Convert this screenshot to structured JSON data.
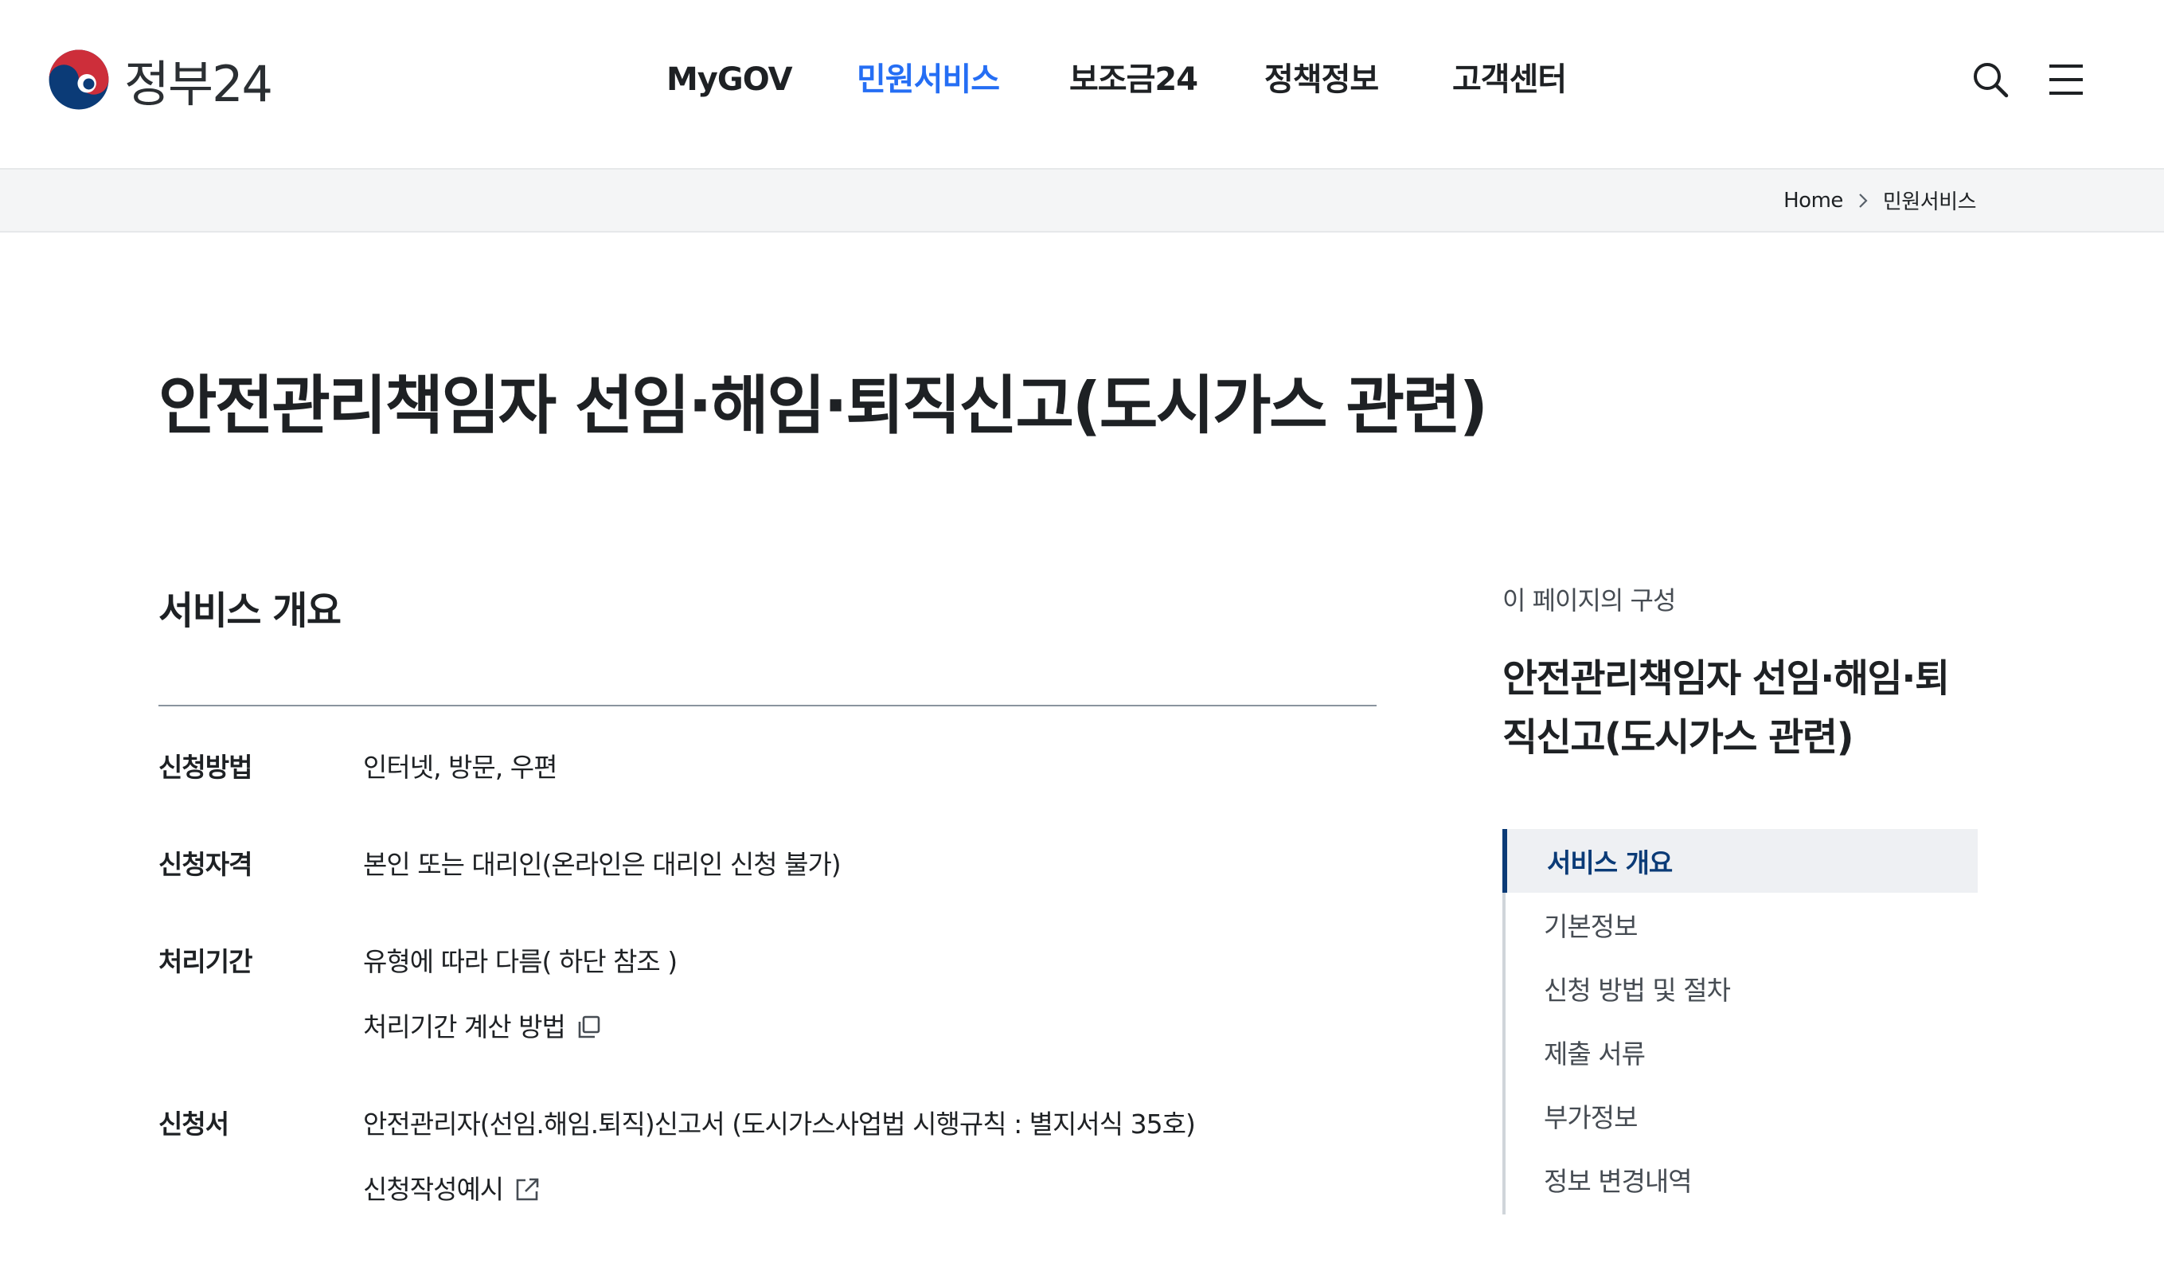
{
  "header": {
    "logo_text": "정부24",
    "nav": [
      {
        "label": "MyGOV",
        "active": false
      },
      {
        "label": "민원서비스",
        "active": true
      },
      {
        "label": "보조금24",
        "active": false
      },
      {
        "label": "정책정보",
        "active": false
      },
      {
        "label": "고객센터",
        "active": false
      }
    ],
    "icons": [
      "search-icon",
      "menu-icon"
    ],
    "accent_color": "#256ef4"
  },
  "breadcrumb": {
    "items": [
      "Home",
      "민원서비스"
    ]
  },
  "page": {
    "title": "안전관리책임자 선임·해임·퇴직신고(도시가스 관련)"
  },
  "overview": {
    "title": "서비스 개요",
    "rows": [
      {
        "label": "신청방법",
        "values": [
          "인터넷, 방문, 우편"
        ]
      },
      {
        "label": "신청자격",
        "values": [
          "본인 또는 대리인(온라인은 대리인 신청 불가)"
        ]
      },
      {
        "label": "처리기간",
        "values": [
          "유형에 따라 다름( 하단 참조 )"
        ],
        "link": "처리기간 계산 방법",
        "link_icon": "copy-icon"
      },
      {
        "label": "신청서",
        "values": [
          "안전관리자(선임.해임.퇴직)신고서 (도시가스사업법 시행규칙 : 별지서식 35호)"
        ],
        "link": "신청작성예시",
        "link_icon": "external-link-icon"
      }
    ]
  },
  "side": {
    "caption": "이 페이지의 구성",
    "title": "안전관리책임자 선임·해임·퇴직신고(도시가스 관련)",
    "items": [
      {
        "label": "서비스 개요",
        "active": true
      },
      {
        "label": "기본정보",
        "active": false
      },
      {
        "label": "신청 방법 및 절차",
        "active": false
      },
      {
        "label": "제출 서류",
        "active": false
      },
      {
        "label": "부가정보",
        "active": false
      },
      {
        "label": "정보 변경내역",
        "active": false
      }
    ],
    "active_color": "#0b3b77"
  }
}
